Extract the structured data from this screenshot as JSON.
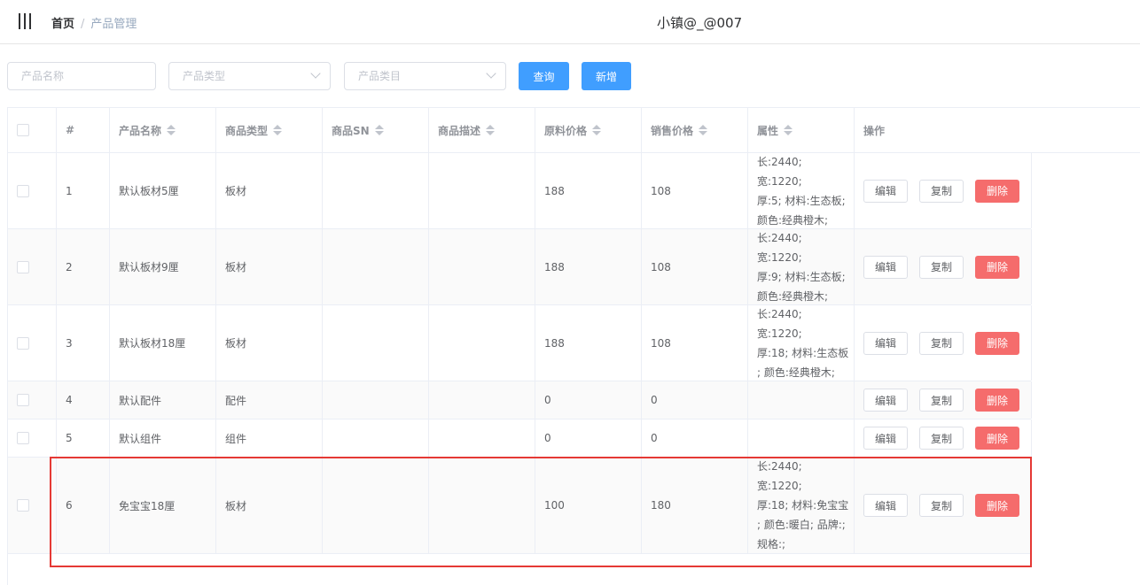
{
  "header": {
    "breadcrumb": {
      "home": "首页",
      "separator": "/",
      "current": "产品管理"
    },
    "user_name": "小镇@_@007"
  },
  "filters": {
    "name_placeholder": "产品名称",
    "type_placeholder": "产品类型",
    "category_placeholder": "产品类目",
    "query_label": "查询",
    "add_label": "新增"
  },
  "table": {
    "columns": [
      "#",
      "产品名称",
      "商品类型",
      "商品SN",
      "商品描述",
      "原料价格",
      "销售价格",
      "属性",
      "操作"
    ],
    "actions": {
      "edit": "编辑",
      "copy": "复制",
      "delete": "删除"
    },
    "rows": [
      {
        "index": "1",
        "name": "默认板材5厘",
        "type": "板材",
        "sn": "",
        "desc": "",
        "raw_price": "188",
        "sale_price": "108",
        "attr": "长:2440; 宽:1220;\n厚:5; 材料:生态板;\n颜色:经典橙木;"
      },
      {
        "index": "2",
        "name": "默认板材9厘",
        "type": "板材",
        "sn": "",
        "desc": "",
        "raw_price": "188",
        "sale_price": "108",
        "attr": "长:2440; 宽:1220;\n厚:9; 材料:生态板;\n颜色:经典橙木;"
      },
      {
        "index": "3",
        "name": "默认板材18厘",
        "type": "板材",
        "sn": "",
        "desc": "",
        "raw_price": "188",
        "sale_price": "108",
        "attr": "长:2440; 宽:1220;\n厚:18; 材料:生态板\n; 颜色:经典橙木;"
      },
      {
        "index": "4",
        "name": "默认配件",
        "type": "配件",
        "sn": "",
        "desc": "",
        "raw_price": "0",
        "sale_price": "0",
        "attr": ""
      },
      {
        "index": "5",
        "name": "默认组件",
        "type": "组件",
        "sn": "",
        "desc": "",
        "raw_price": "0",
        "sale_price": "0",
        "attr": ""
      },
      {
        "index": "6",
        "name": "免宝宝18厘",
        "type": "板材",
        "sn": "",
        "desc": "",
        "raw_price": "100",
        "sale_price": "180",
        "attr": "长:2440; 宽:1220;\n厚:18; 材料:免宝宝\n; 颜色:暖白; 品牌:;\n规格:;"
      }
    ]
  },
  "colors": {
    "primary": "#409eff",
    "danger": "#f56c6c",
    "highlight": "#e53935",
    "stripe": "#fafafa"
  }
}
